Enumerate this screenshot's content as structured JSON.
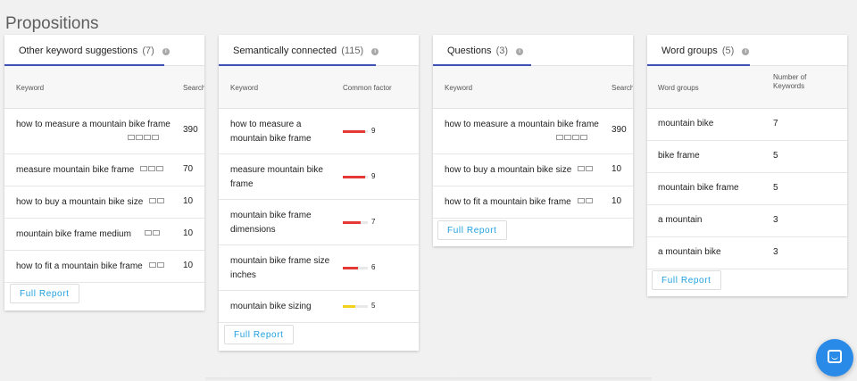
{
  "page": {
    "title": "Propositions"
  },
  "cards": {
    "other": {
      "tab_label": "Other keyword suggestions",
      "tab_count": "(7)",
      "col_keyword": "Keyword",
      "col_search": "Search",
      "rows": [
        {
          "keyword": "how to measure a mountain bike frame",
          "search": "390"
        },
        {
          "keyword": "measure mountain bike frame",
          "search": "70"
        },
        {
          "keyword": "how to buy a mountain bike size",
          "search": "10"
        },
        {
          "keyword": "mountain bike frame medium",
          "search": "10"
        },
        {
          "keyword": "how to fit a mountain bike frame",
          "search": "10"
        }
      ],
      "button": "Full Report"
    },
    "semantic": {
      "tab_label": "Semantically connected",
      "tab_count": "(115)",
      "col_keyword": "Keyword",
      "col_factor": "Common factor",
      "rows": [
        {
          "keyword": "how to measure a mountain bike frame",
          "factor": "9",
          "level": 0.9,
          "color": "#e53935"
        },
        {
          "keyword": "measure mountain bike frame",
          "factor": "9",
          "level": 0.9,
          "color": "#e53935"
        },
        {
          "keyword": "mountain bike frame dimensions",
          "factor": "7",
          "level": 0.7,
          "color": "#e53935"
        },
        {
          "keyword": "mountain bike frame size inches",
          "factor": "6",
          "level": 0.6,
          "color": "#e53935"
        },
        {
          "keyword": "mountain bike sizing",
          "factor": "5",
          "level": 0.5,
          "color": "#f2d21b"
        }
      ],
      "button": "Full Report"
    },
    "questions": {
      "tab_label": "Questions",
      "tab_count": "(3)",
      "col_keyword": "Keyword",
      "col_search": "Search",
      "rows": [
        {
          "keyword": "how to measure a mountain bike frame",
          "search": "390"
        },
        {
          "keyword": "how to buy a mountain bike size",
          "search": "10"
        },
        {
          "keyword": "how to fit a mountain bike frame",
          "search": "10"
        }
      ],
      "button": "Full Report"
    },
    "groups": {
      "tab_label": "Word groups",
      "tab_count": "(5)",
      "col_group": "Word groups",
      "col_number": "Number of Keywords",
      "rows": [
        {
          "group": "mountain bike",
          "count": "7"
        },
        {
          "group": "bike frame",
          "count": "5"
        },
        {
          "group": "mountain bike frame",
          "count": "5"
        },
        {
          "group": "a mountain",
          "count": "3"
        },
        {
          "group": "a mountain bike",
          "count": "3"
        }
      ],
      "button": "Full Report"
    }
  },
  "colors": {
    "accent": "#3f51b5",
    "link": "#1fa0e0",
    "fab": "#2a8ae8"
  },
  "icons": {
    "info": "info-icon",
    "serp_feature": "serp-feature-icon",
    "chat": "chat-icon"
  }
}
